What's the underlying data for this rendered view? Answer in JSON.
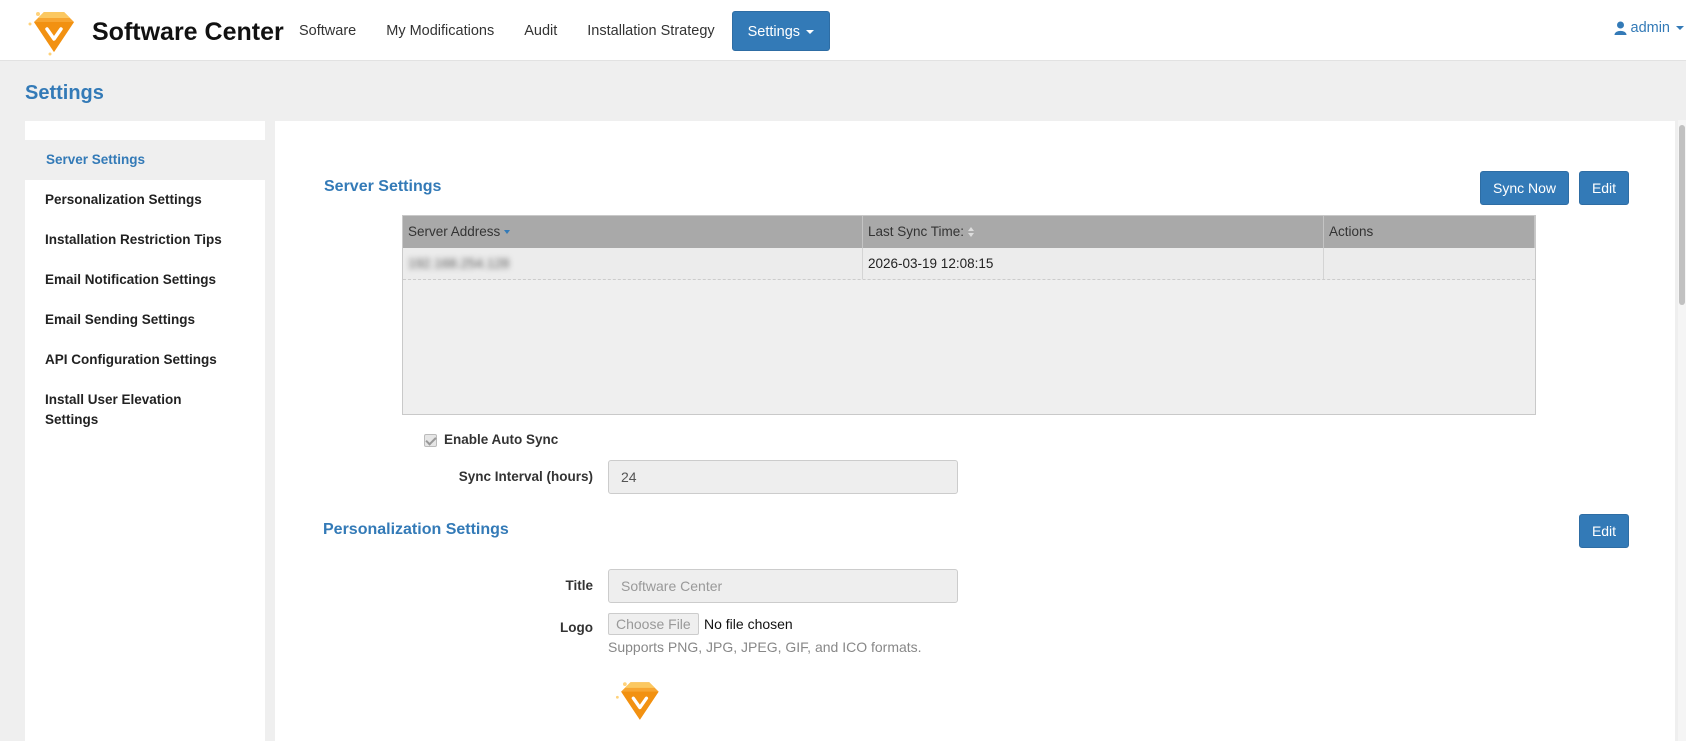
{
  "app": {
    "title": "Software Center",
    "logo_icon": "diamond-logo-icon",
    "accent_color": "#337ab7"
  },
  "nav": {
    "items": [
      {
        "label": "Software"
      },
      {
        "label": "My Modifications"
      },
      {
        "label": "Audit"
      },
      {
        "label": "Installation Strategy"
      },
      {
        "label": "Settings",
        "active": true
      }
    ],
    "user": "admin",
    "user_icon": "user-icon"
  },
  "page": {
    "title": "Settings"
  },
  "sidebar": {
    "items": [
      {
        "label": "Server Settings",
        "active": true
      },
      {
        "label": "Personalization Settings"
      },
      {
        "label": "Installation Restriction Tips"
      },
      {
        "label": "Email Notification Settings"
      },
      {
        "label": "Email Sending Settings"
      },
      {
        "label": "API Configuration Settings"
      },
      {
        "label": "Install User Elevation Settings"
      }
    ]
  },
  "server_settings": {
    "title": "Server Settings",
    "sync_now_label": "Sync Now",
    "edit_label": "Edit",
    "table": {
      "columns": [
        "Server Address",
        "Last Sync Time:",
        "Actions"
      ],
      "rows": [
        {
          "address": "192.168.254.128",
          "last_sync": "2026-03-19 12:08:15",
          "actions": ""
        }
      ]
    },
    "auto_sync_label": "Enable Auto Sync",
    "auto_sync_checked": true,
    "interval_label": "Sync Interval (hours)",
    "interval_value": "24"
  },
  "personalization": {
    "title": "Personalization Settings",
    "edit_label": "Edit",
    "title_label": "Title",
    "title_placeholder": "Software Center",
    "logo_label": "Logo",
    "choose_file_label": "Choose File",
    "no_file_text": "No file chosen",
    "formats_hint": "Supports PNG, JPG, JPEG, GIF, and ICO formats."
  }
}
